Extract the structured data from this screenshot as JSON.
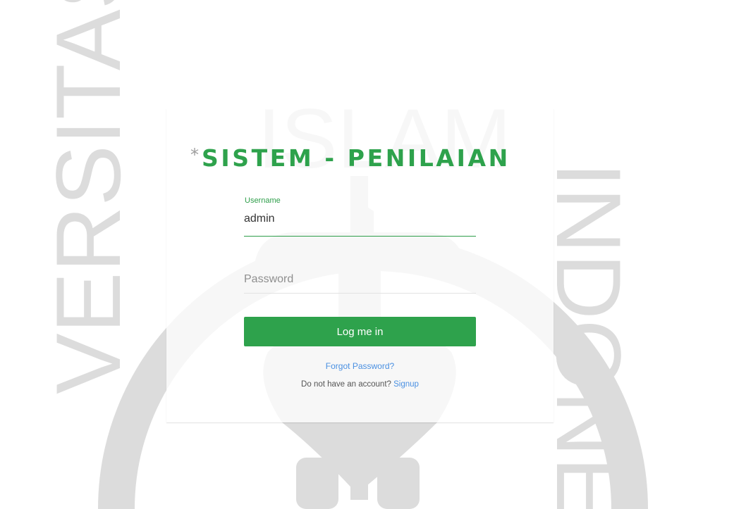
{
  "colors": {
    "accent": "#2ea24c",
    "link": "#4a90e2",
    "watermark": "#d9d9d9"
  },
  "background": {
    "watermark_text": "UNIVERSITAS ISLAM INDONESIA"
  },
  "login": {
    "brand_star": "*",
    "brand_title": "SISTEM - PENILAIAN",
    "username_label": "Username",
    "username_value": "admin",
    "password_placeholder": "Password",
    "submit_label": "Log me in",
    "forgot_label": "Forgot Password?",
    "signup_prompt": "Do not have an account?",
    "signup_label": "Signup"
  }
}
